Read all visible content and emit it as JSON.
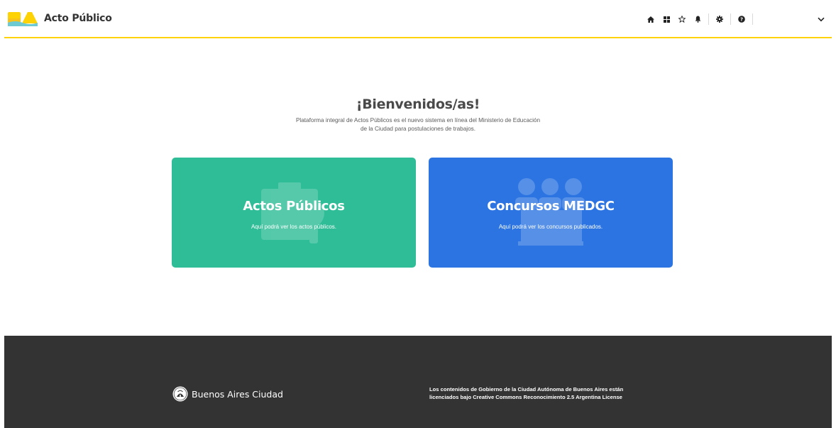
{
  "header": {
    "brand": "Acto Público",
    "logo_colors": [
      "#fdd306",
      "#f8a73b",
      "#6dcad3"
    ],
    "icons": [
      "home-icon",
      "grid-icon",
      "star-icon",
      "bell-icon",
      "gear-icon",
      "help-icon"
    ]
  },
  "welcome": {
    "title": "¡Bienvenidos/as!",
    "description_line1": "Plataforma integral de Actos Públicos es el nuevo sistema en línea del Ministerio de Educación",
    "description_line2": "de la Ciudad para postulaciones de trabajos."
  },
  "cards": {
    "actos": {
      "title": "Actos Públicos",
      "subtitle": "Aquí podrá ver los actos públicos.",
      "color": "#2fbd97"
    },
    "concursos": {
      "title": "Concursos MEDGC",
      "subtitle": "Aquí podrá ver los concursos publicados.",
      "color": "#2b74e2"
    }
  },
  "footer": {
    "brand": "Buenos Aires Ciudad",
    "license_line1": "Los contenidos de Gobierno de la Ciudad Autónoma de Buenos Aires están",
    "license_line2": "licenciados bajo Creative Commons Reconocimiento 2.5 Argentina License",
    "background": "#333333"
  },
  "colors": {
    "accent": "#fdd306"
  }
}
